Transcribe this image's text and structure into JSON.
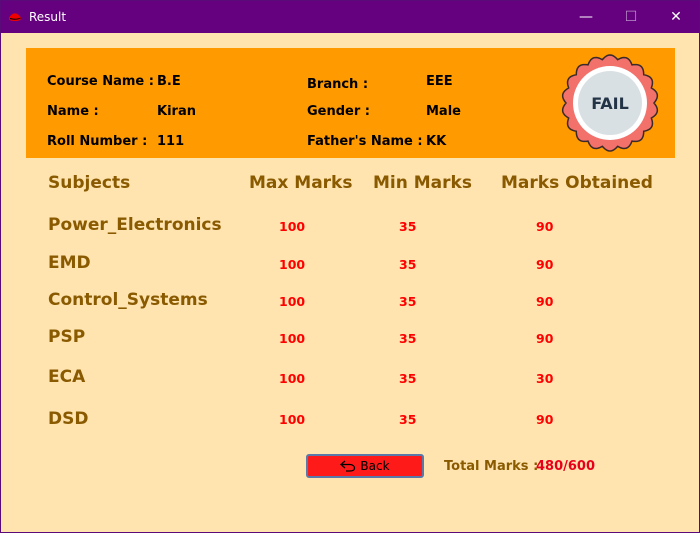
{
  "window": {
    "title": "Result",
    "minimize_glyph": "—",
    "maximize_glyph": "☐",
    "close_glyph": "✕",
    "app_icon": "red-hat-icon"
  },
  "student": {
    "course_label": "Course Name :",
    "course_value": "B.E",
    "name_label": "Name :",
    "name_value": "Kiran",
    "roll_label": "Roll Number  :",
    "roll_value": "111",
    "branch_label": "Branch :",
    "branch_value": "EEE",
    "gender_label": "Gender :",
    "gender_value": "Male",
    "father_label": "Father's Name :",
    "father_value": "KK"
  },
  "result_badge": {
    "text": "FAIL",
    "outer_color": "#f2716b",
    "inner_color": "#d9e0e3",
    "text_color": "#243447"
  },
  "table": {
    "headers": {
      "subject": "Subjects",
      "max": "Max Marks",
      "min": "Min Marks",
      "obtained": "Marks Obtained"
    },
    "rows": [
      {
        "subject": "Power_Electronics",
        "max": "100",
        "min": "35",
        "obtained": "90"
      },
      {
        "subject": "EMD",
        "max": "100",
        "min": "35",
        "obtained": "90"
      },
      {
        "subject": "Control_Systems",
        "max": "100",
        "min": "35",
        "obtained": "90"
      },
      {
        "subject": "PSP",
        "max": "100",
        "min": "35",
        "obtained": "90"
      },
      {
        "subject": "ECA",
        "max": "100",
        "min": "35",
        "obtained": "30"
      },
      {
        "subject": "DSD",
        "max": "100",
        "min": "35",
        "obtained": "90"
      }
    ]
  },
  "footer": {
    "back_label": "Back",
    "back_icon": "undo-arrow-icon",
    "total_label": "Total Marks :",
    "total_value": "480/600"
  },
  "colors": {
    "background": "#ffe4b0",
    "titlebar": "#65007f",
    "header_panel": "#ff9a00",
    "subject_text": "#8a5a00",
    "marks_text": "#ff0000",
    "back_button": "#ff1a1a"
  }
}
